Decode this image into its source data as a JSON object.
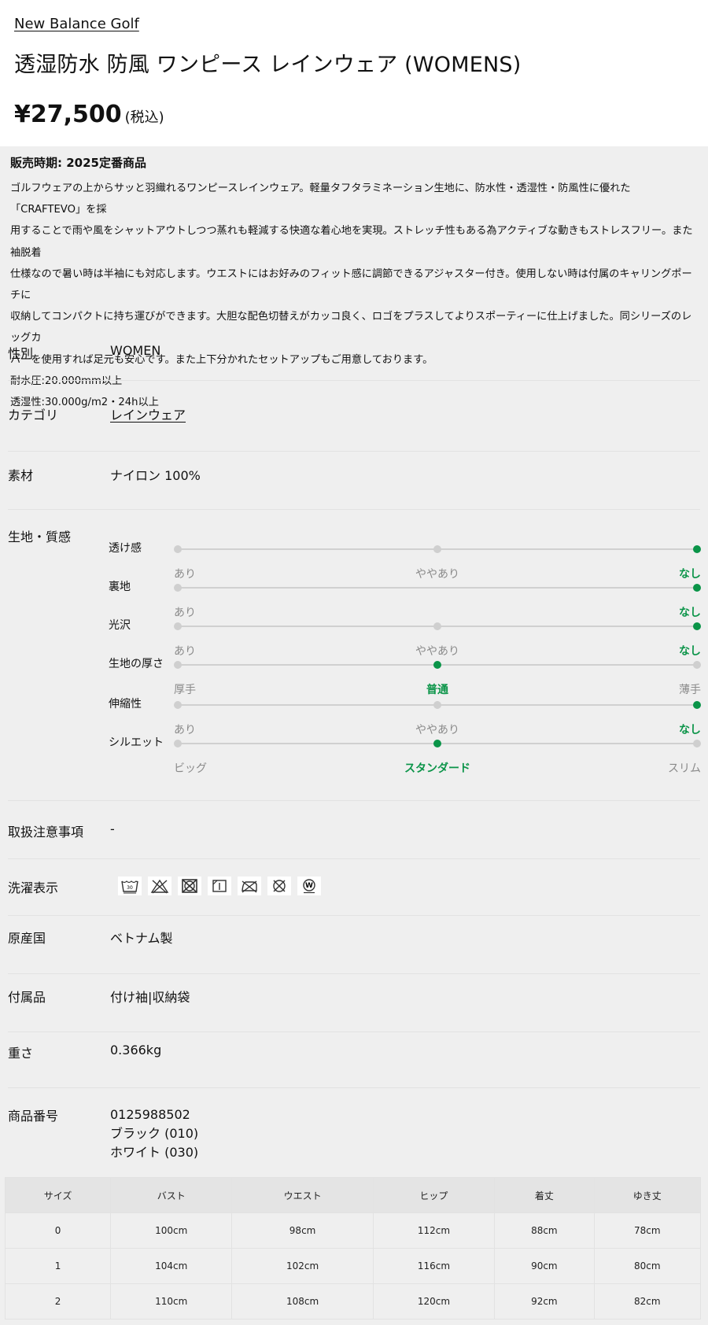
{
  "brand": "New Balance Golf",
  "product": {
    "title": "透湿防水 防風 ワンピース レインウェア (WOMENS)",
    "price": "¥27,500",
    "tax_note": "(税込)"
  },
  "season": "販売時期: 2025定番商品",
  "description": [
    "ゴルフウェアの上からサッと羽織れるワンピースレインウェア。軽量タフタラミネーション生地に、防水性・透湿性・防風性に優れた「CRAFTEVO」を採",
    "用することで雨や風をシャットアウトしつつ蒸れも軽減する快適な着心地を実現。ストレッチ性もある為アクティブな動きもストレスフリー。また袖脱着",
    "仕様なので暑い時は半袖にも対応します。ウエストにはお好みのフィット感に調節できるアジャスター付き。使用しない時は付属のキャリングポーチに",
    "収納してコンパクトに持ち運びができます。大胆な配色切替えがカッコ良く、ロゴをプラスしてよりスポーティーに仕上げました。同シリーズのレッグカ",
    "バーを使用すれば足元も安心です。また上下分かれたセットアップもご用意しております。",
    "耐水圧:20.000mm以上",
    "透湿性:30.000g/m2・24h以上"
  ],
  "specs": {
    "gender_label": "性別",
    "gender_value": "WOMEN",
    "category_label": "カテゴリ",
    "category_value": "レインウェア",
    "material_label": "素材",
    "material_value": "ナイロン 100%",
    "texture_label": "生地・質感",
    "care_notes_label": "取扱注意事項",
    "care_notes_value": "-",
    "washing_label": "洗濯表示",
    "origin_label": "原産国",
    "origin_value": "ベトナム製",
    "accessories_label": "付属品",
    "accessories_value": "付け袖|収納袋",
    "weight_label": "重さ",
    "weight_value": "0.366kg",
    "product_no_label": "商品番号",
    "product_no_value": "0125988502",
    "color_1": "ブラック (010)",
    "color_2": "ホワイト (030)"
  },
  "texture": [
    {
      "name": "透け感",
      "options": [
        "あり",
        "ややあり",
        "なし"
      ],
      "selected": 2
    },
    {
      "name": "裏地",
      "options": [
        "あり",
        "なし"
      ],
      "selected": 1
    },
    {
      "name": "光沢",
      "options": [
        "あり",
        "ややあり",
        "なし"
      ],
      "selected": 2
    },
    {
      "name": "生地の厚さ",
      "options": [
        "厚手",
        "普通",
        "薄手"
      ],
      "selected": 1
    },
    {
      "name": "伸縮性",
      "options": [
        "あり",
        "ややあり",
        "なし"
      ],
      "selected": 2
    },
    {
      "name": "シルエット",
      "options": [
        "ビッグ",
        "スタンダード",
        "スリム"
      ],
      "selected": 1
    }
  ],
  "washing_icons": [
    "wash-30-icon",
    "no-bleach-icon",
    "no-tumble-dry-icon",
    "line-dry-shade-icon",
    "no-iron-icon",
    "no-dry-clean-icon",
    "wet-clean-icon"
  ],
  "accent_color": "#0a9448",
  "size_table": {
    "headers": [
      "サイズ",
      "バスト",
      "ウエスト",
      "ヒップ",
      "着丈",
      "ゆき丈"
    ],
    "rows": [
      [
        "0",
        "100cm",
        "98cm",
        "112cm",
        "88cm",
        "78cm"
      ],
      [
        "1",
        "104cm",
        "102cm",
        "116cm",
        "90cm",
        "80cm"
      ],
      [
        "2",
        "110cm",
        "108cm",
        "120cm",
        "92cm",
        "82cm"
      ]
    ]
  }
}
